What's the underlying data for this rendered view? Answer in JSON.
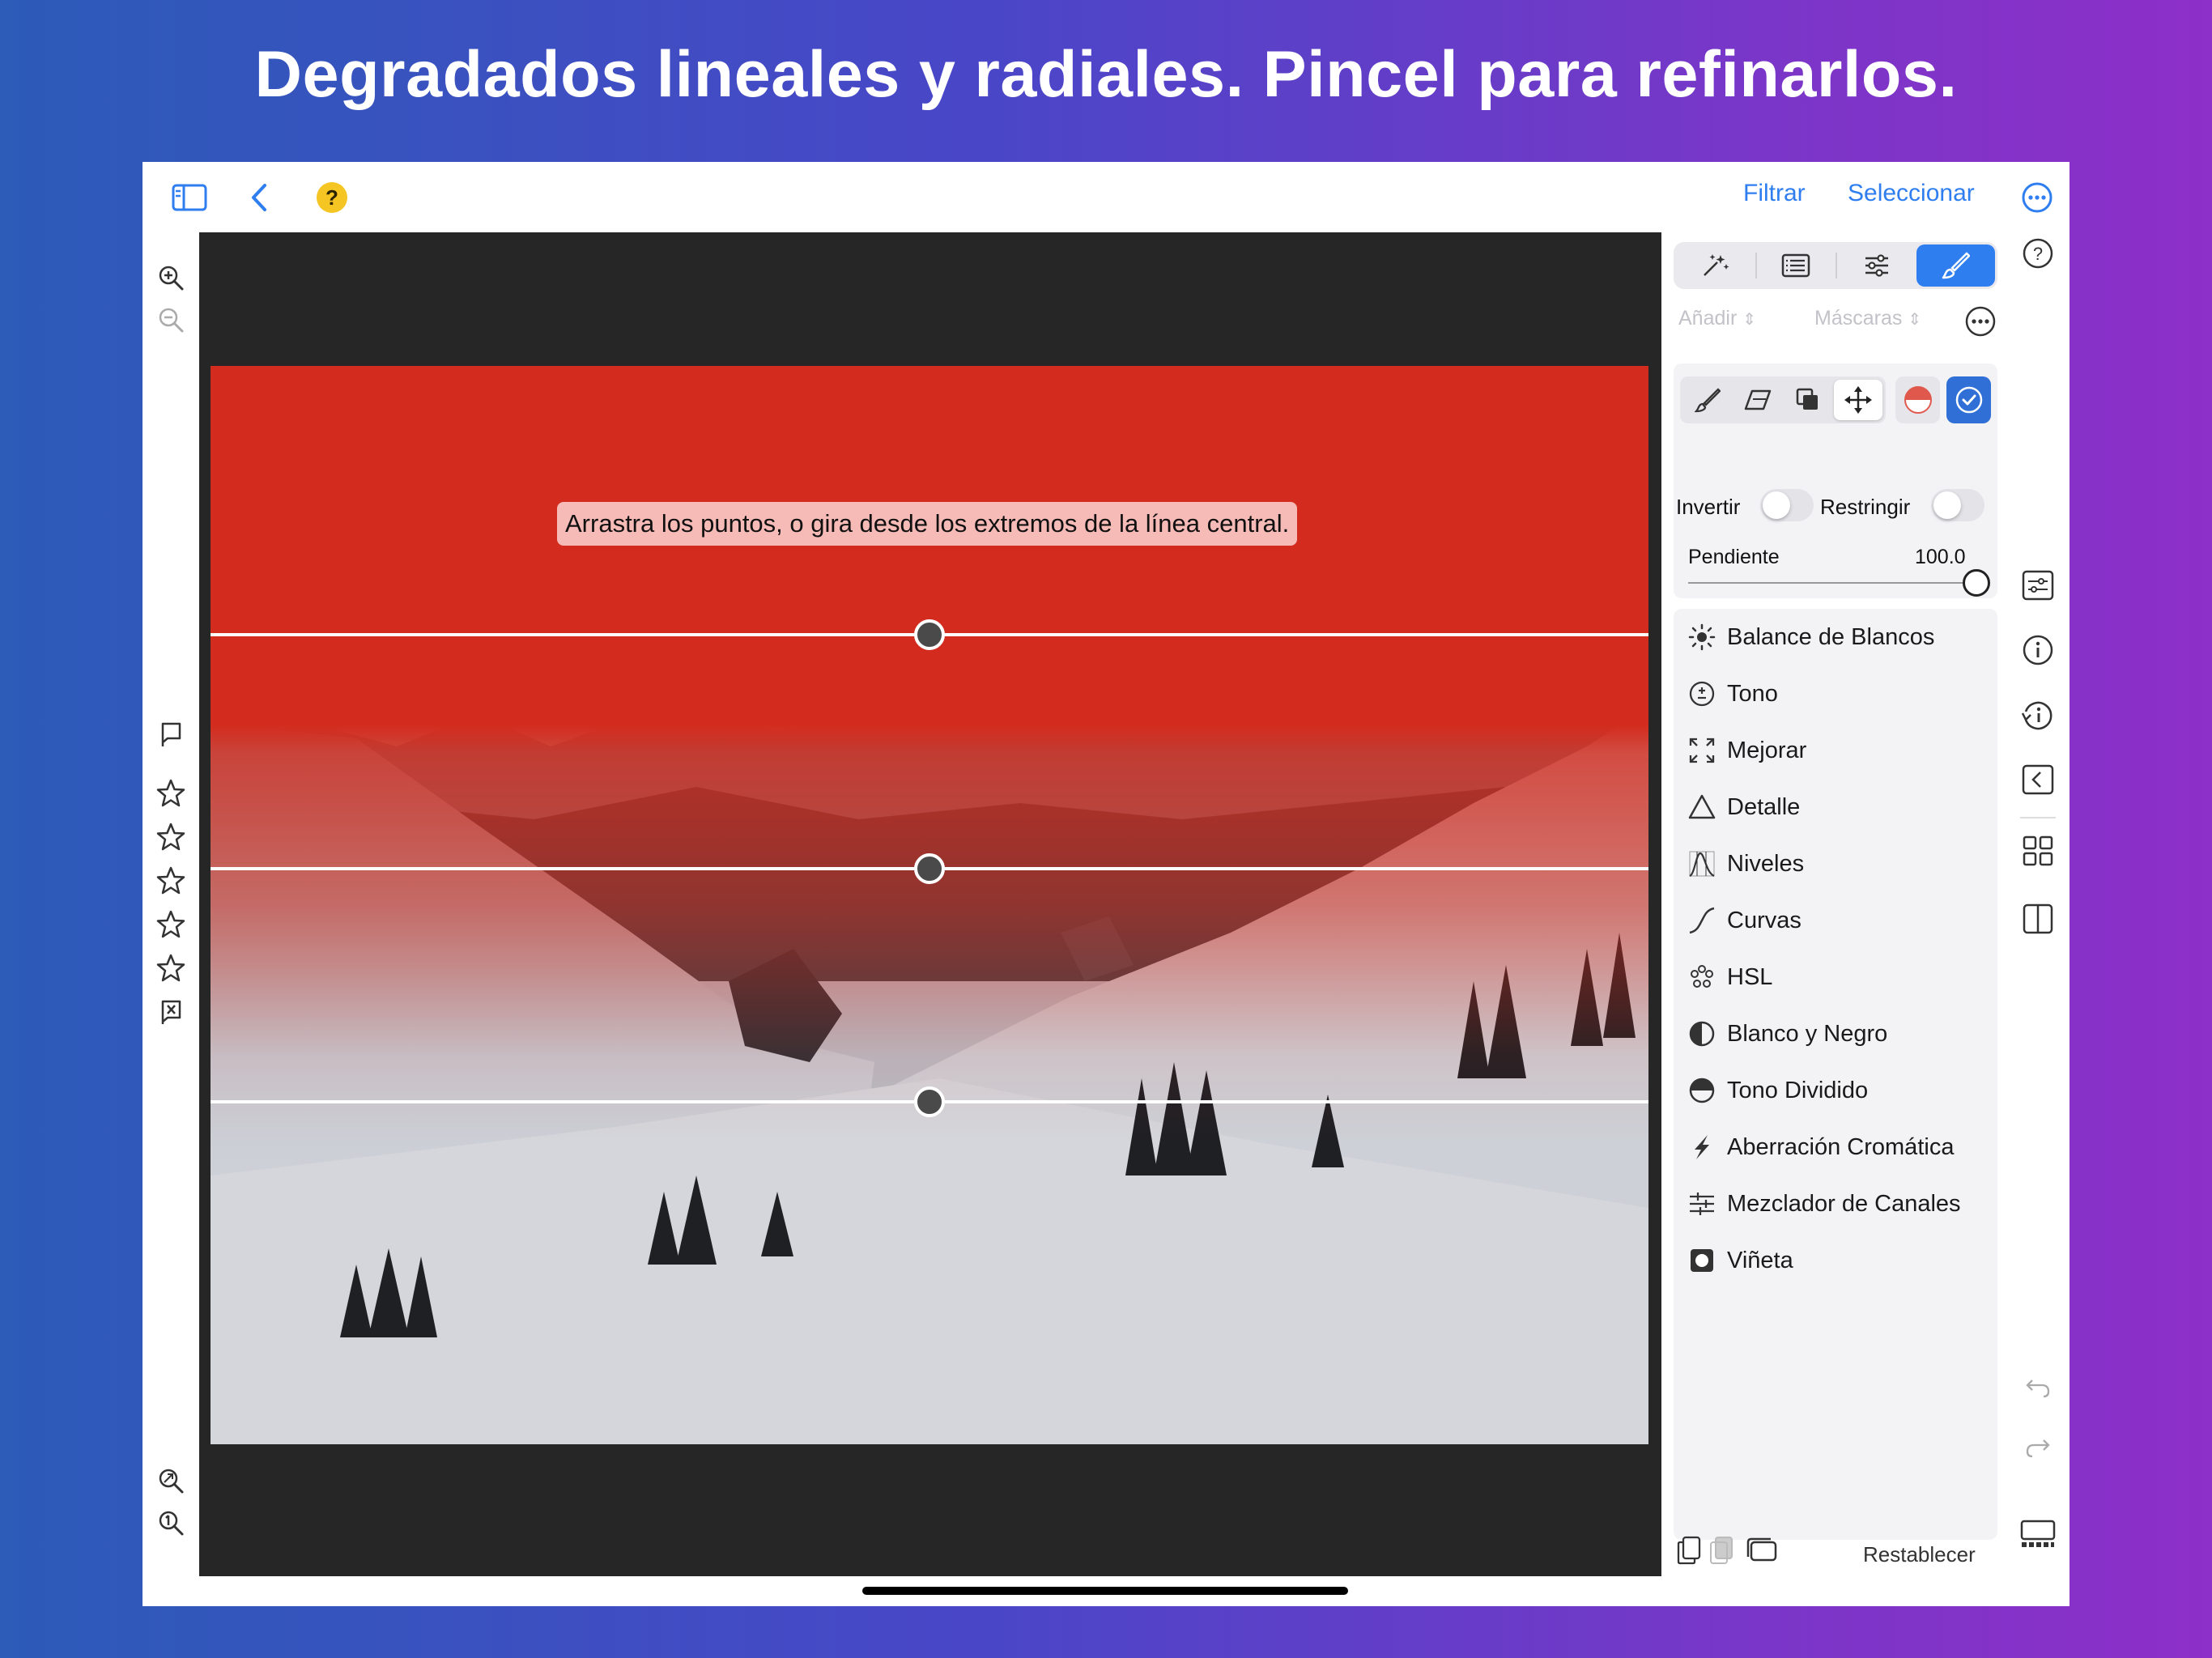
{
  "headline": "Degradados lineales y radiales. Pincel para refinarlos.",
  "topbar": {
    "help_glyph": "?",
    "filter_label": "Filtrar",
    "select_label": "Seleccionar",
    "icons": [
      "sidebar-icon",
      "back-chevron-icon",
      "help-icon",
      "more-icon"
    ]
  },
  "canvas": {
    "hint": "Arrastra los puntos, o gira desde los extremos de la línea central.",
    "mask_color": "#d32c1e"
  },
  "panel": {
    "tabs": [
      "auto-enhance-icon",
      "presets-icon",
      "adjust-icon",
      "mask-brush-icon"
    ],
    "active_tab": 3,
    "add_label": "Añadir",
    "masks_label": "Máscaras",
    "invert_label": "Invertir",
    "restrict_label": "Restringir",
    "slope_label": "Pendiente",
    "slope_value": "100.0",
    "slope_fraction": 1.0,
    "reset_label": "Restablecer",
    "adjustments": [
      {
        "label": "Balance de Blancos",
        "icon": "sun-icon"
      },
      {
        "label": "Tono",
        "icon": "plus-minus-icon"
      },
      {
        "label": "Mejorar",
        "icon": "expand-icon"
      },
      {
        "label": "Detalle",
        "icon": "triangle-icon"
      },
      {
        "label": "Niveles",
        "icon": "histogram-icon"
      },
      {
        "label": "Curvas",
        "icon": "curve-icon"
      },
      {
        "label": "HSL",
        "icon": "hsl-dots-icon"
      },
      {
        "label": "Blanco y Negro",
        "icon": "half-circle-icon"
      },
      {
        "label": "Tono Dividido",
        "icon": "split-tone-icon"
      },
      {
        "label": "Aberración Cromática",
        "icon": "lightning-icon"
      },
      {
        "label": "Mezclador de Canales",
        "icon": "mixer-icon"
      },
      {
        "label": "Viñeta",
        "icon": "vignette-icon"
      }
    ]
  },
  "colors": {
    "accent": "#2f7ef0",
    "mask_red": "#d32c1e",
    "help_yellow": "#f5c523"
  }
}
